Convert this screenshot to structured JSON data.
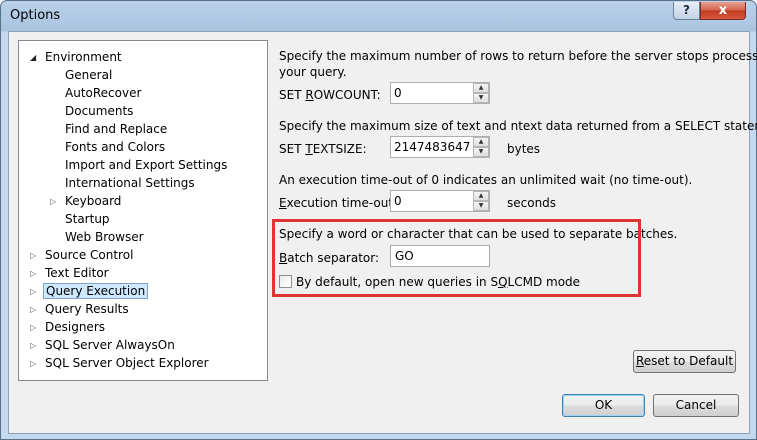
{
  "window": {
    "title": "Options",
    "help_label": "?",
    "close_label": "x"
  },
  "tree": {
    "items": [
      {
        "label": "Environment",
        "arrow": "open"
      },
      {
        "label": "General"
      },
      {
        "label": "AutoRecover"
      },
      {
        "label": "Documents"
      },
      {
        "label": "Find and Replace"
      },
      {
        "label": "Fonts and Colors"
      },
      {
        "label": "Import and Export Settings"
      },
      {
        "label": "International Settings"
      },
      {
        "label": "Keyboard",
        "arrow": "closed"
      },
      {
        "label": "Startup"
      },
      {
        "label": "Web Browser"
      },
      {
        "label": "Source Control",
        "arrow": "closed"
      },
      {
        "label": "Text Editor",
        "arrow": "closed"
      },
      {
        "label": "Query Execution",
        "arrow": "closed",
        "selected": true
      },
      {
        "label": "Query Results",
        "arrow": "closed"
      },
      {
        "label": "Designers",
        "arrow": "closed"
      },
      {
        "label": "SQL Server AlwaysOn",
        "arrow": "closed"
      },
      {
        "label": "SQL Server Object Explorer",
        "arrow": "closed"
      }
    ]
  },
  "panel": {
    "rowcount_desc_1": "Specify the maximum number of rows to return before the server stops processing",
    "rowcount_desc_2": "your query.",
    "rowcount_label_pre": "SET ",
    "rowcount_label_ul": "R",
    "rowcount_label_post": "OWCOUNT:",
    "rowcount_value": "0",
    "textsize_desc": "Specify the maximum size of text and ntext data returned from a SELECT statement.",
    "textsize_label_pre": "SET ",
    "textsize_label_ul": "T",
    "textsize_label_post": "EXTSIZE:",
    "textsize_value": "2147483647",
    "textsize_unit": "bytes",
    "timeout_desc": "An execution time-out of 0 indicates an unlimited wait (no time-out).",
    "timeout_label_ul": "E",
    "timeout_label_post": "xecution time-out:",
    "timeout_value": "0",
    "timeout_unit": "seconds",
    "batch_desc": "Specify a word or character that can be used to separate batches.",
    "batch_label_ul": "B",
    "batch_label_post": "atch separator:",
    "batch_value": "GO",
    "sqlcmd_label_pre": "By default, open new queries in S",
    "sqlcmd_label_ul": "Q",
    "sqlcmd_label_post": "LCMD mode",
    "sqlcmd_checked": false
  },
  "buttons": {
    "reset_pre": "",
    "reset_ul": "R",
    "reset_post": "eset to Default",
    "ok": "OK",
    "cancel": "Cancel"
  },
  "colors": {
    "highlight": "#e03434",
    "selection": "#cde8ff"
  }
}
